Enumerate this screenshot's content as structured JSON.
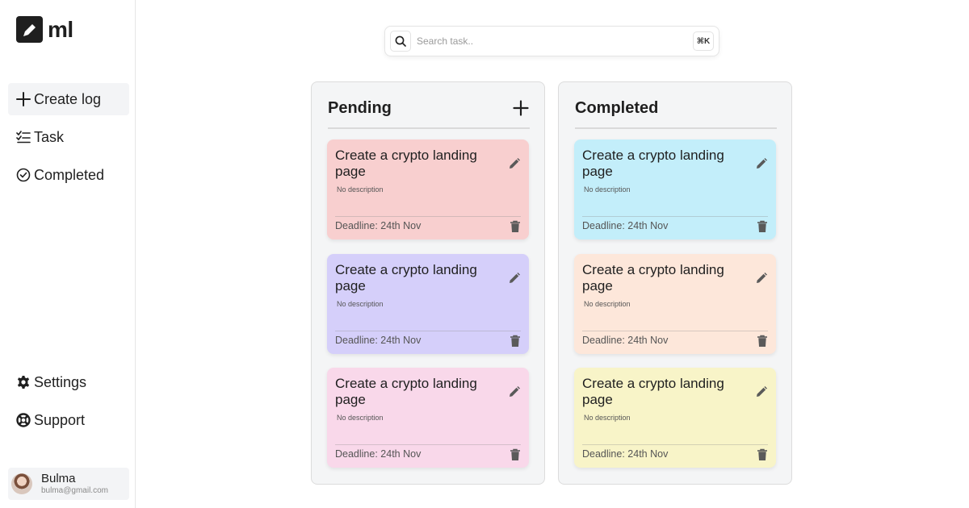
{
  "app": {
    "logo_text": "ml"
  },
  "sidebar": {
    "nav": [
      {
        "label": "Create log",
        "icon": "plus-icon",
        "active": true
      },
      {
        "label": "Task",
        "icon": "task-list-icon",
        "active": false
      },
      {
        "label": "Completed",
        "icon": "check-circle-icon",
        "active": false
      }
    ],
    "bottom_nav": [
      {
        "label": "Settings",
        "icon": "gear-icon"
      },
      {
        "label": "Support",
        "icon": "lifebuoy-icon"
      }
    ],
    "user": {
      "name": "Bulma",
      "email": "bulma@gmail.com"
    }
  },
  "search": {
    "placeholder": "Search task..",
    "shortcut": "⌘K"
  },
  "columns": {
    "pending": {
      "title": "Pending",
      "cards": [
        {
          "title": "Create a crypto landing page",
          "description": "No description",
          "deadline": "Deadline: 24th Nov",
          "color": "#f8cfcf"
        },
        {
          "title": "Create a crypto landing page",
          "description": "No description",
          "deadline": "Deadline: 24th Nov",
          "color": "#d5cffa"
        },
        {
          "title": "Create a crypto landing page",
          "description": "No description",
          "deadline": "Deadline: 24th Nov",
          "color": "#f9d8ea"
        }
      ]
    },
    "completed": {
      "title": "Completed",
      "cards": [
        {
          "title": "Create a crypto landing page",
          "description": "No description",
          "deadline": "Deadline: 24th Nov",
          "color": "#c3eefa"
        },
        {
          "title": "Create a crypto landing page",
          "description": "No description",
          "deadline": "Deadline: 24th Nov",
          "color": "#fde7da"
        },
        {
          "title": "Create a crypto landing page",
          "description": "No description",
          "deadline": "Deadline: 24th Nov",
          "color": "#f8f4c8"
        }
      ]
    }
  }
}
